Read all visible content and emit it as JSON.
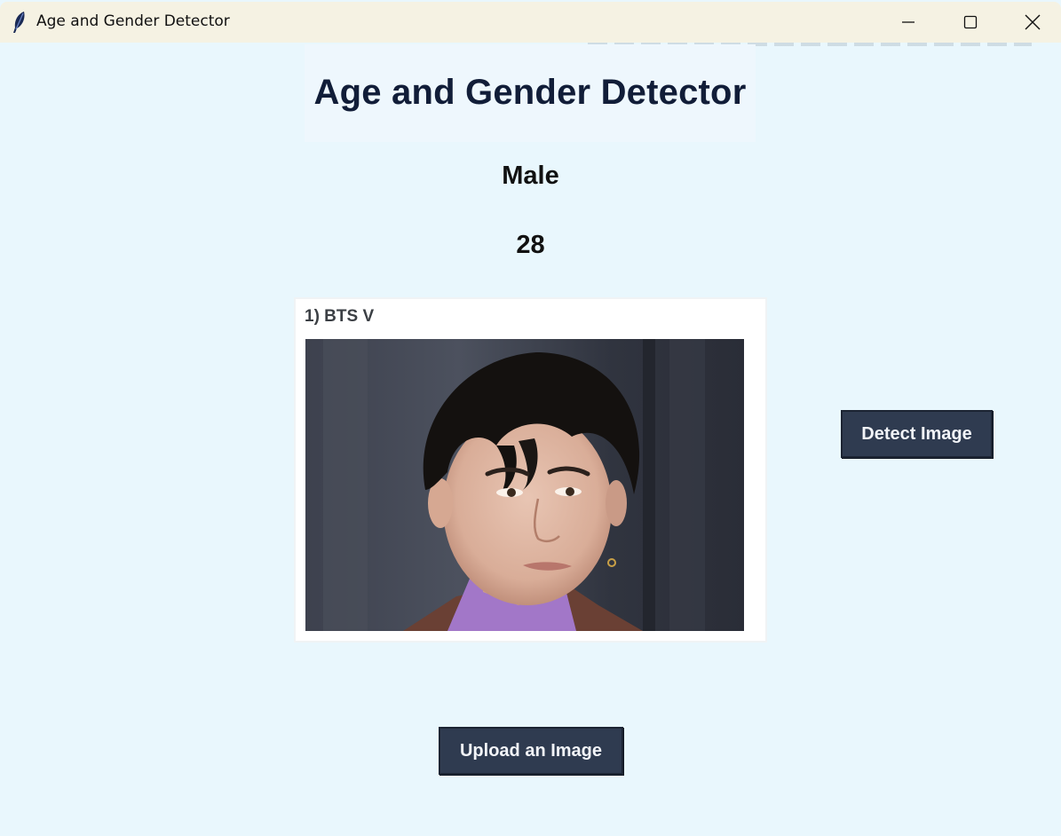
{
  "window": {
    "title": "Age and Gender Detector"
  },
  "icons": {
    "app": "feather-icon",
    "minimize": "minimize-icon",
    "maximize": "maximize-icon",
    "close": "close-icon"
  },
  "main": {
    "heading": "Age and Gender Detector",
    "gender": "Male",
    "age": "28",
    "image_caption": "1) BTS V",
    "detect_button": "Detect Image",
    "upload_button": "Upload an Image"
  },
  "colors": {
    "background": "#e9f7fd",
    "titlebar": "#f5f2e3",
    "heading": "#111d38",
    "button": "#2f3b50",
    "button_text": "#f2f4f8"
  }
}
